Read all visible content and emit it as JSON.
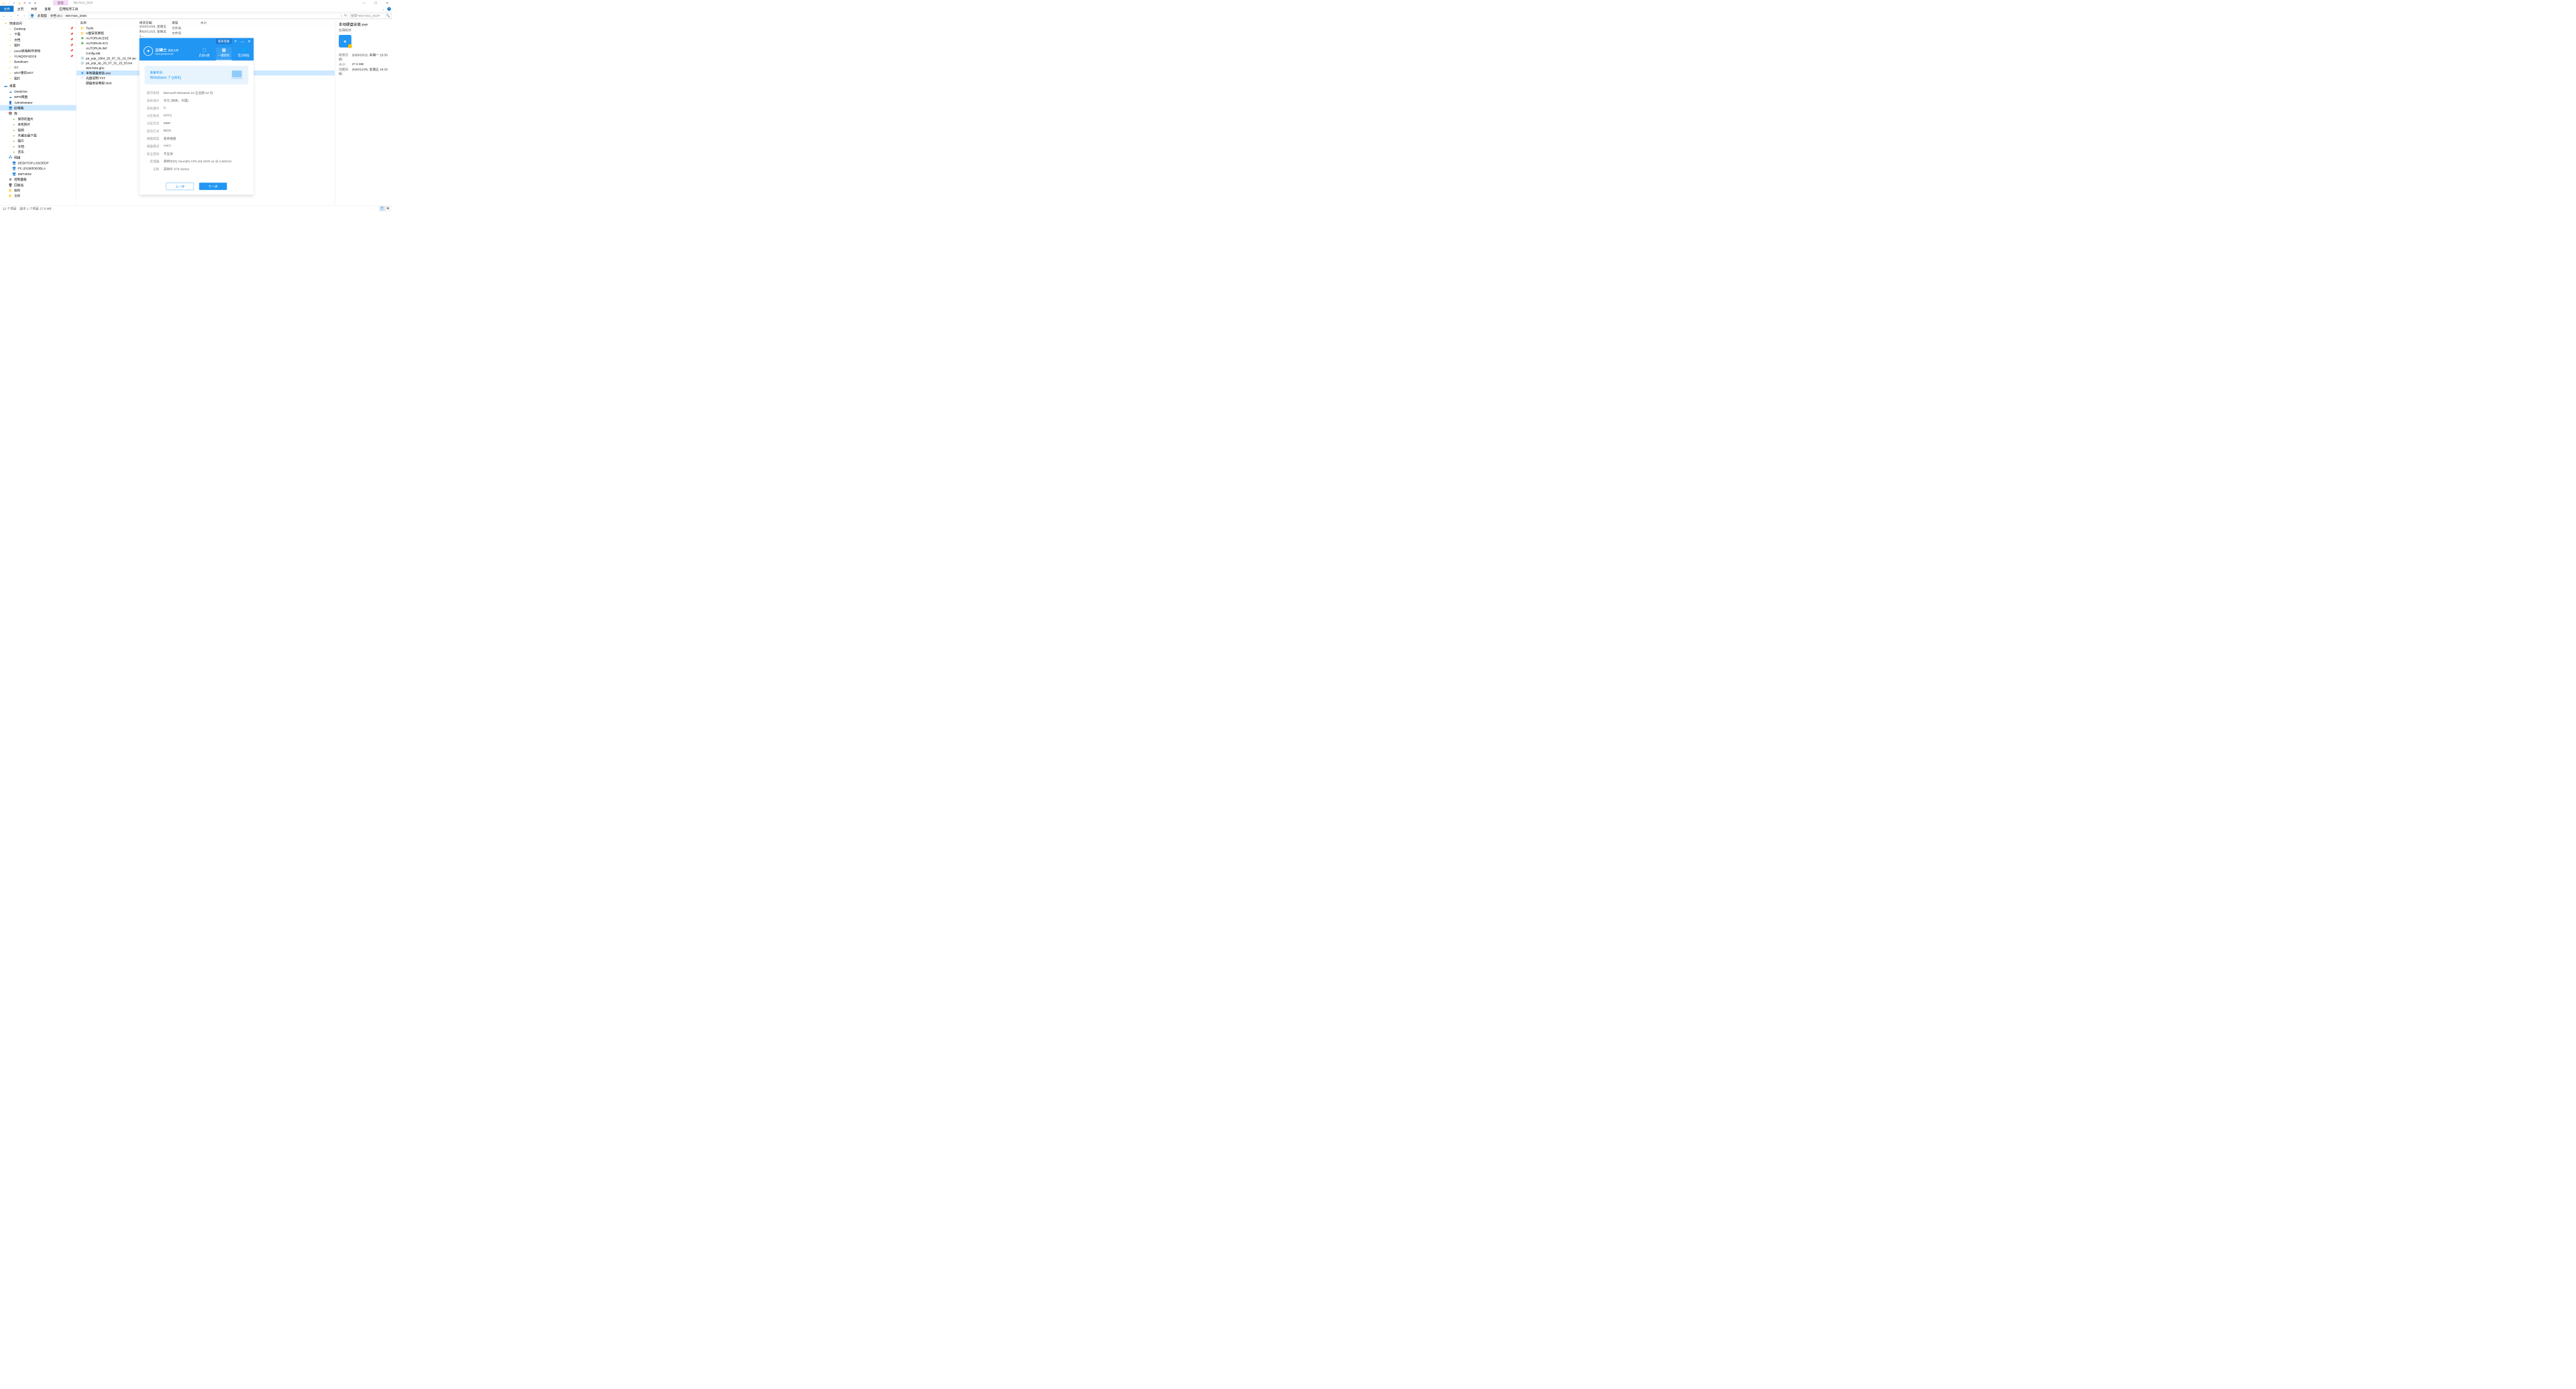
{
  "titlebar": {
    "mgmt_tab": "管理",
    "window_title": "Win7x64_2020"
  },
  "ribbon": {
    "tabs": [
      "文件",
      "主页",
      "共享",
      "查看",
      "应用程序工具"
    ]
  },
  "breadcrumb": {
    "parts": [
      "此电脑",
      "文档 (E:)",
      "Win7x64_2020"
    ]
  },
  "search": {
    "placeholder": "搜索\"Win7x64_2020\""
  },
  "nav": {
    "quick_access": "快速访问",
    "items_qa": [
      {
        "label": "Desktop",
        "pin": true
      },
      {
        "label": "下载",
        "pin": true
      },
      {
        "label": "文档",
        "pin": true
      },
      {
        "label": "图片",
        "pin": true
      },
      {
        "label": "excel表格制作求和",
        "pin": true
      },
      {
        "label": "YUNQISHI2019",
        "pin": true
      },
      {
        "label": "Bandicam",
        "pin": false
      },
      {
        "label": "G:\\",
        "pin": false
      },
      {
        "label": "win7重装win7",
        "pin": false
      },
      {
        "label": "图片",
        "pin": false
      }
    ],
    "desktop": "桌面",
    "items_desktop": [
      "OneDrive",
      "WPS网盘",
      "Administrator",
      "此电脑",
      "库"
    ],
    "items_lib": [
      "保存的图片",
      "本机照片",
      "视频",
      "天翼云盘下载",
      "图片",
      "文档",
      "音乐"
    ],
    "network": "网络",
    "items_net": [
      "DESKTOP-LSSOEDP",
      "PC-20190530OBLA",
      "ZMT2019"
    ],
    "cpanel": "控制面板",
    "recycle": "回收站",
    "software": "软件",
    "files": "文件"
  },
  "columns": {
    "name": "名称",
    "date": "修改日期",
    "type": "类型",
    "size": "大小"
  },
  "files": [
    {
      "name": "Tools",
      "date": "2020/12/25, 星期五 1...",
      "type": "文件夹",
      "ico": "folder"
    },
    {
      "name": "U盘安装教程",
      "date": "2020/12/25, 星期五 1...",
      "type": "文件夹",
      "ico": "folder"
    },
    {
      "name": "AUTORUN.EXE",
      "date": "",
      "type": "",
      "ico": "app-green"
    },
    {
      "name": "AUTORUN.ICO",
      "date": "",
      "type": "",
      "ico": "app-green"
    },
    {
      "name": "AUTORUN.INF",
      "date": "",
      "type": "",
      "ico": "file"
    },
    {
      "name": "Config.dat",
      "date": "",
      "type": "",
      "ico": "file"
    },
    {
      "name": "pe_yqs_1064_20_07_31_16_04.iso",
      "date": "",
      "type": "",
      "ico": "iso"
    },
    {
      "name": "pe_yqs_xp_20_07_31_15_53.iso",
      "date": "",
      "type": "",
      "ico": "iso"
    },
    {
      "name": "Win7x64.gho",
      "date": "",
      "type": "",
      "ico": "file"
    },
    {
      "name": "本地硬盘安装.exe",
      "date": "",
      "type": "",
      "ico": "app-blue",
      "selected": true
    },
    {
      "name": "光盘说明.TXT",
      "date": "",
      "type": "",
      "ico": "txt"
    },
    {
      "name": "硬盘安装教程.html",
      "date": "",
      "type": "",
      "ico": "file"
    }
  ],
  "details": {
    "title": "本地硬盘安装.exe",
    "subtype": "应用程序",
    "meta": [
      {
        "label": "修改日期:",
        "val": "2020/10/12, 星期一 15:30"
      },
      {
        "label": "大小:",
        "val": "27.6 MB"
      },
      {
        "label": "创建日期:",
        "val": "2020/12/25, 星期五 16:33"
      }
    ]
  },
  "statusbar": {
    "count": "12 个项目",
    "selected": "选中 1 个项目  27.6 MB"
  },
  "overlay": {
    "contact": "联系客服",
    "brand": "云骑士",
    "brand_sub": "装机大师",
    "brand_url": "www.yunqishi.net",
    "tabs": [
      {
        "label": "启动U盘"
      },
      {
        "label": "一键装机",
        "active": true
      },
      {
        "label": "官方网址"
      }
    ],
    "prep_title": "准备安装:",
    "prep_os": "Windows 7 (x64)",
    "info": [
      {
        "label": "操作系统",
        "val": "Microsoft Windows 10 企业版 64 位"
      },
      {
        "label": "系统语言",
        "val": "中文 (简体，中国)"
      },
      {
        "label": "系统盘符",
        "val": "C:"
      },
      {
        "label": "分区格式",
        "val": "NTFS"
      },
      {
        "label": "分区形式",
        "val": "MBR"
      },
      {
        "label": "启动方式",
        "val": "BIOS"
      },
      {
        "label": "磁盘类型",
        "val": "基本磁盘"
      },
      {
        "label": "磁盘模式",
        "val": "AHCI"
      },
      {
        "label": "安全启动",
        "val": "不支持"
      },
      {
        "label": "处理器",
        "val": "英特尔(R) Xeon(R) CPU E5-2670 v2 @ 2.50GHz"
      },
      {
        "label": "主板",
        "val": "英特尔 X79 Series"
      }
    ],
    "btn_prev": "上一步",
    "btn_next": "下一步"
  }
}
